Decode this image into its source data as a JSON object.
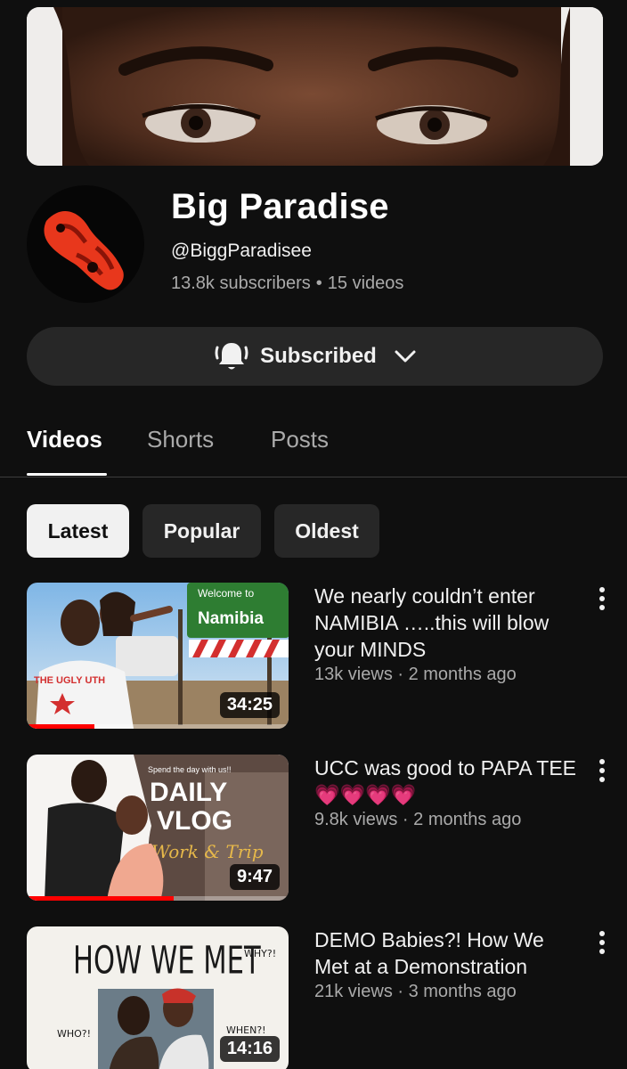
{
  "channel": {
    "name": "Big Paradise",
    "handle": "@BiggParadisee",
    "subscribers": "13.8k subscribers",
    "separator": "•",
    "video_count": "15 videos"
  },
  "subscribe_button": {
    "label": "Subscribed",
    "bell_icon": "bell-icon",
    "chevron_icon": "chevron-down-icon"
  },
  "tabs": [
    {
      "label": "Videos",
      "active": true
    },
    {
      "label": "Shorts",
      "active": false
    },
    {
      "label": "Posts",
      "active": false
    }
  ],
  "filters": [
    {
      "label": "Latest",
      "active": true
    },
    {
      "label": "Popular",
      "active": false
    },
    {
      "label": "Oldest",
      "active": false
    }
  ],
  "videos": [
    {
      "title": "We nearly couldn’t enter NAMIBIA …..this will blow your MINDS",
      "meta": "13k views · 2 months ago",
      "duration": "34:25",
      "watched_fraction": 0.26,
      "thumb_text": [
        "Welcome to",
        "Namibia",
        "THE UGLY UTH"
      ]
    },
    {
      "title": "UCC was good to PAPA TEE 💗💗💗💗",
      "meta": "9.8k views · 2 months ago",
      "duration": "9:47",
      "watched_fraction": 0.56,
      "thumb_text": [
        "Spend the day with us!!",
        "DAILY",
        "VLOG",
        "Work & Trip"
      ]
    },
    {
      "title": "DEMO Babies?! How We Met at a Demonstration",
      "meta": "21k views · 3 months ago",
      "duration": "14:16",
      "watched_fraction": 0,
      "thumb_text": [
        "HOW WE MET",
        "WHY?!",
        "WHO?!",
        "WHEN?!"
      ]
    }
  ],
  "colors": {
    "background": "#0f0f0f",
    "surface": "#272727",
    "accent": "#ff0000",
    "secondary_text": "#aaaaaa"
  }
}
